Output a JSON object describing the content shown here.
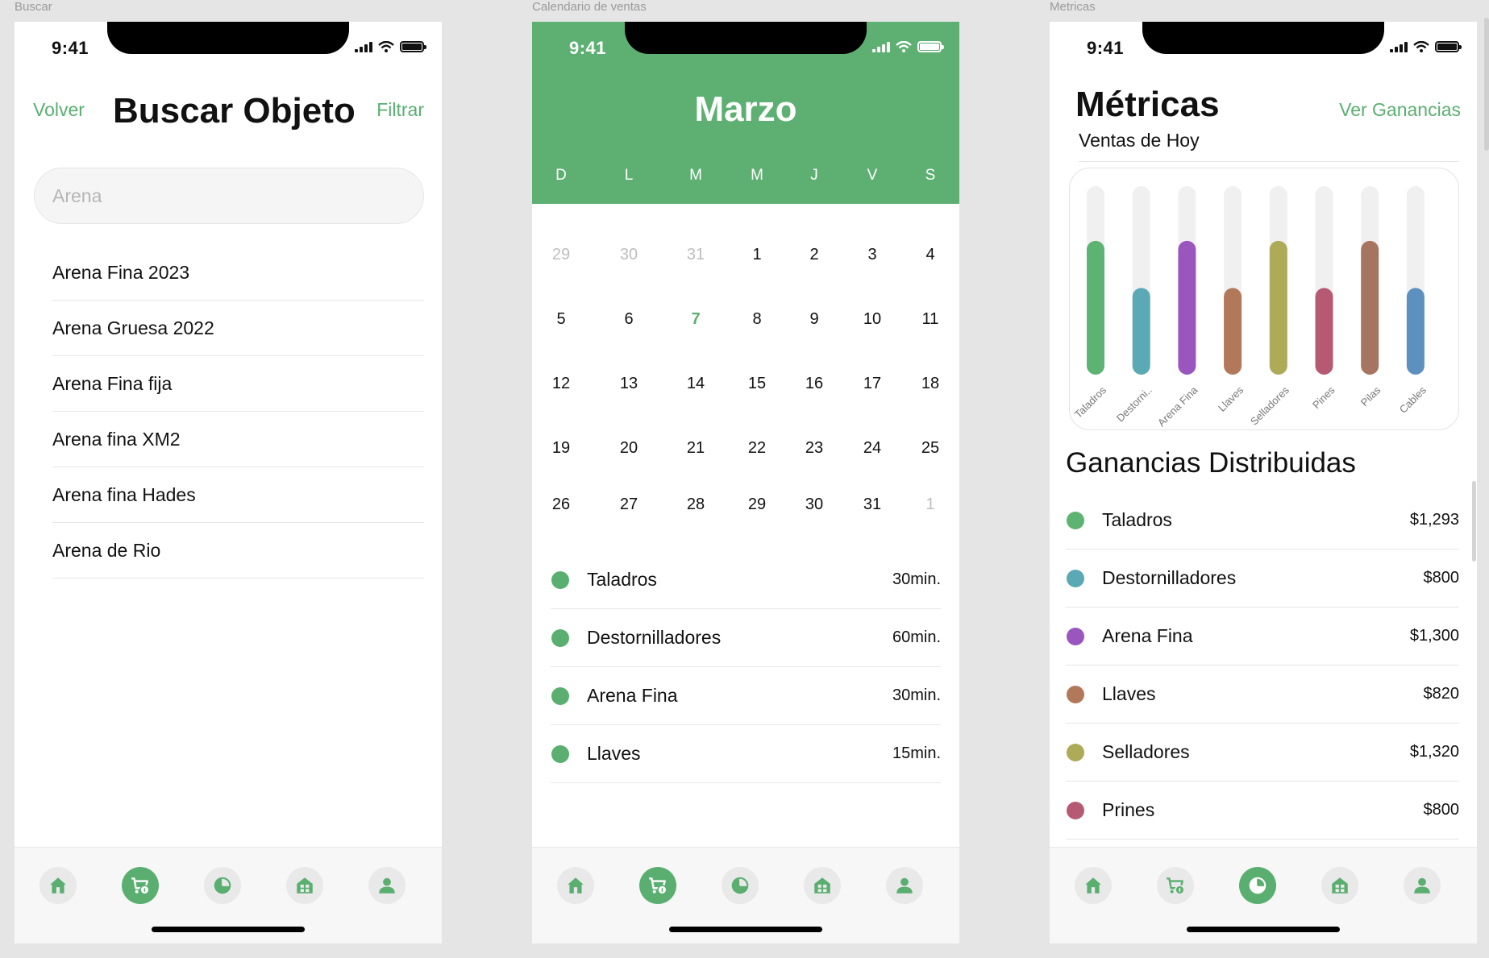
{
  "frames": [
    {
      "label": "Buscar"
    },
    {
      "label": "Calendario de ventas"
    },
    {
      "label": "Metricas"
    }
  ],
  "status_time": "9:41",
  "buscar": {
    "back_label": "Volver",
    "title": "Buscar Objeto",
    "filter_label": "Filtrar",
    "search_placeholder": "Arena",
    "results": [
      "Arena Fina 2023",
      "Arena Gruesa 2022",
      "Arena Fina fija",
      "Arena fina XM2",
      "Arena fina Hades",
      "Arena de Rio"
    ]
  },
  "calendario": {
    "month": "Marzo",
    "weekdays": [
      "D",
      "L",
      "M",
      "M",
      "J",
      "V",
      "S"
    ],
    "weeks": [
      [
        "29",
        "30",
        "31",
        "1",
        "2",
        "3",
        "4"
      ],
      [
        "5",
        "6",
        "7",
        "8",
        "9",
        "10",
        "11"
      ],
      [
        "12",
        "13",
        "14",
        "15",
        "16",
        "17",
        "18"
      ],
      [
        "19",
        "20",
        "21",
        "22",
        "23",
        "24",
        "25"
      ],
      [
        "26",
        "27",
        "28",
        "29",
        "30",
        "31",
        "1"
      ]
    ],
    "muted_days": [
      [
        0,
        0
      ],
      [
        0,
        1
      ],
      [
        0,
        2
      ],
      [
        4,
        6
      ]
    ],
    "today": [
      1,
      2
    ],
    "today_color": "#5aaf70",
    "schedule": [
      {
        "label": "Taladros",
        "value": "30min."
      },
      {
        "label": "Destornilladores",
        "value": "60min."
      },
      {
        "label": "Arena Fina",
        "value": "30min."
      },
      {
        "label": "Llaves",
        "value": "15min."
      }
    ]
  },
  "metricas": {
    "title": "Métricas",
    "link_label": "Ver Ganancias",
    "subtitle": "Ventas de Hoy",
    "section_title": "Ganancias Distribuidas",
    "chart_data": {
      "type": "bar",
      "categories": [
        "Taladros",
        "Destorni..",
        "Arena Fina",
        "Llaves",
        "Selladores",
        "Pines",
        "Pilas",
        "Cables"
      ],
      "values": [
        0.71,
        0.46,
        0.71,
        0.46,
        0.71,
        0.46,
        0.71,
        0.46
      ],
      "ylim": [
        0,
        1
      ],
      "colors": [
        "#5db372",
        "#5ba9b4",
        "#9a56be",
        "#b2785a",
        "#adaa58",
        "#b65a74",
        "#a67561",
        "#5c90be"
      ],
      "track_color": "#f0f0f0",
      "grid": false,
      "legend": "none"
    },
    "earnings": [
      {
        "label": "Taladros",
        "value": "$1,293",
        "color": "#5db372"
      },
      {
        "label": "Destornilladores",
        "value": "$800",
        "color": "#5ba9b4"
      },
      {
        "label": "Arena Fina",
        "value": "$1,300",
        "color": "#9a56be"
      },
      {
        "label": "Llaves",
        "value": "$820",
        "color": "#b2785a"
      },
      {
        "label": "Selladores",
        "value": "$1,320",
        "color": "#adaa58"
      },
      {
        "label": "Prines",
        "value": "$800",
        "color": "#b65a74"
      }
    ]
  },
  "accent_color": "#5aaf70",
  "tabs": [
    {
      "icon": "home-icon"
    },
    {
      "icon": "cart-icon"
    },
    {
      "icon": "pie-chart-icon"
    },
    {
      "icon": "store-icon"
    },
    {
      "icon": "user-icon"
    }
  ]
}
